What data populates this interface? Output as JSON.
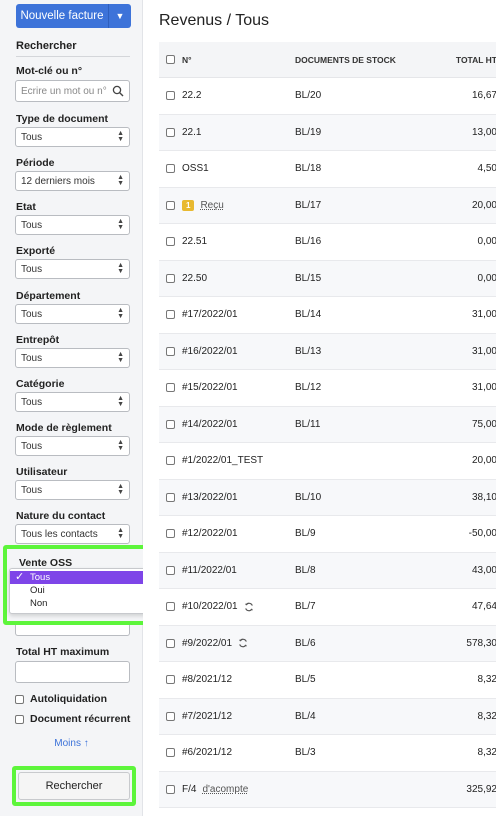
{
  "sidebar": {
    "new_invoice_label": "Nouvelle facture",
    "search_title": "Rechercher",
    "keyword": {
      "label": "Mot-clé ou n°",
      "placeholder": "Ecrire un mot ou n°"
    },
    "filters": [
      {
        "label": "Type de document",
        "value": "Tous"
      },
      {
        "label": "Période",
        "value": "12 derniers mois"
      },
      {
        "label": "Etat",
        "value": "Tous"
      },
      {
        "label": "Exporté",
        "value": "Tous"
      },
      {
        "label": "Département",
        "value": "Tous"
      },
      {
        "label": "Entrepôt",
        "value": "Tous"
      },
      {
        "label": "Catégorie",
        "value": "Tous"
      },
      {
        "label": "Mode de règlement",
        "value": "Tous"
      },
      {
        "label": "Utilisateur",
        "value": "Tous"
      },
      {
        "label": "Nature du contact",
        "value": "Tous les contacts"
      }
    ],
    "oss": {
      "label": "Vente OSS",
      "options": [
        "Tous",
        "Oui",
        "Non"
      ],
      "selected": "Tous"
    },
    "total_ht_max": {
      "label": "Total HT maximum"
    },
    "checkboxes": [
      "Autoliquidation",
      "Document récurrent"
    ],
    "less_label": "Moins",
    "search_button": "Rechercher"
  },
  "main": {
    "title": "Revenus / Tous",
    "columns": [
      "N°",
      "DOCUMENTS DE STOCK",
      "TOTAL HT"
    ],
    "rows": [
      {
        "num": "22.2",
        "doc": "BL/20",
        "total": "16,67"
      },
      {
        "num": "22.1",
        "doc": "BL/19",
        "total": "13,00"
      },
      {
        "num": "OSS1",
        "doc": "BL/18",
        "total": "4,50"
      },
      {
        "num": "Reçu",
        "badge": "1",
        "doc": "BL/17",
        "total": "20,00",
        "link": true
      },
      {
        "num": "22.51",
        "doc": "BL/16",
        "total": "0,00"
      },
      {
        "num": "22.50",
        "doc": "BL/15",
        "total": "0,00"
      },
      {
        "num": "#17/2022/01",
        "doc": "BL/14",
        "total": "31,00"
      },
      {
        "num": "#16/2022/01",
        "doc": "BL/13",
        "total": "31,00"
      },
      {
        "num": "#15/2022/01",
        "doc": "BL/12",
        "total": "31,00"
      },
      {
        "num": "#14/2022/01",
        "doc": "BL/11",
        "total": "75,00"
      },
      {
        "num": "#1/2022/01_TEST",
        "doc": "",
        "total": "20,00"
      },
      {
        "num": "#13/2022/01",
        "doc": "BL/10",
        "total": "38,10"
      },
      {
        "num": "#12/2022/01",
        "doc": "BL/9",
        "total": "-50,00"
      },
      {
        "num": "#11/2022/01",
        "doc": "BL/8",
        "total": "43,00"
      },
      {
        "num": "#10/2022/01",
        "doc": "BL/7",
        "total": "47,64",
        "sync": true
      },
      {
        "num": "#9/2022/01",
        "doc": "BL/6",
        "total": "578,30",
        "sync": true
      },
      {
        "num": "#8/2021/12",
        "doc": "BL/5",
        "total": "8,32"
      },
      {
        "num": "#7/2021/12",
        "doc": "BL/4",
        "total": "8,32"
      },
      {
        "num": "#6/2021/12",
        "doc": "BL/3",
        "total": "8,32"
      },
      {
        "num": "F/4",
        "doc": "",
        "total": "325,92",
        "suffix_link": "d'acompte"
      }
    ]
  },
  "colors": {
    "primary": "#3d73d9",
    "highlight": "#5df53b",
    "selected_option": "#7e45e8",
    "badge": "#e8b930"
  }
}
